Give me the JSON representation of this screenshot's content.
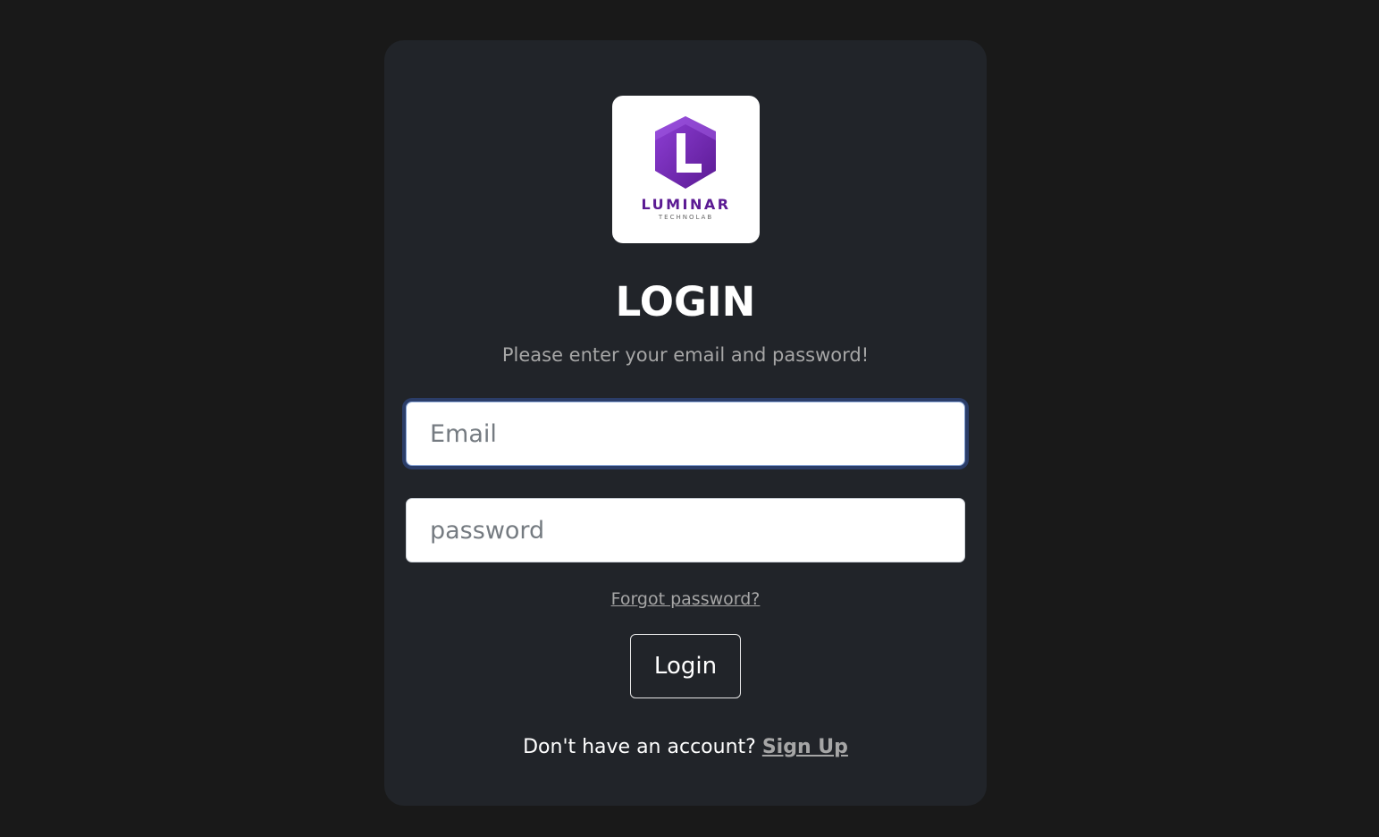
{
  "logo": {
    "brand": "LUMINAR",
    "tagline": "TECHNOLAB",
    "colors": {
      "primary": "#7b2cbf",
      "dark": "#5b1a93"
    }
  },
  "heading": "LOGIN",
  "subtitle": "Please enter your email and password!",
  "form": {
    "email_placeholder": "Email",
    "password_placeholder": "password"
  },
  "forgot_link": "Forgot password?",
  "login_button": "Login",
  "signup": {
    "prompt": "Don't have an account?",
    "link": "Sign Up"
  }
}
